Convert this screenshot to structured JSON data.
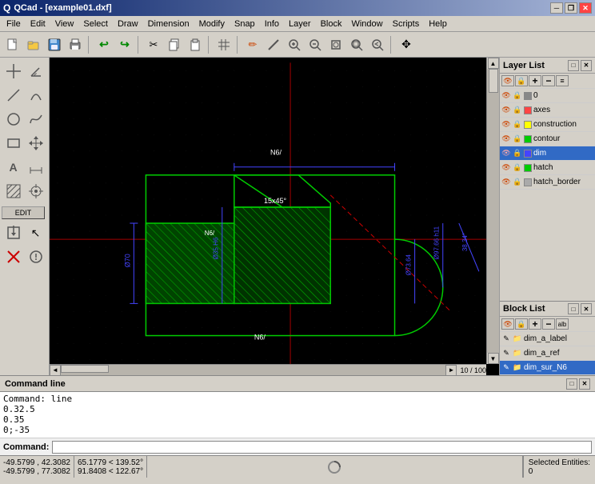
{
  "titlebar": {
    "title": "QCad - [example01.dxf]",
    "icon": "Q",
    "min_btn": "─",
    "max_btn": "□",
    "close_btn": "✕",
    "restore_btn": "❐"
  },
  "menubar": {
    "items": [
      "File",
      "Edit",
      "View",
      "Select",
      "Draw",
      "Dimension",
      "Modify",
      "Snap",
      "Info",
      "Layer",
      "Block",
      "Window",
      "Scripts",
      "Help"
    ]
  },
  "toolbar": {
    "buttons": [
      {
        "name": "new",
        "icon": "📄"
      },
      {
        "name": "open",
        "icon": "📂"
      },
      {
        "name": "save",
        "icon": "💾"
      },
      {
        "name": "print",
        "icon": "🖨"
      },
      {
        "name": "sep1",
        "icon": ""
      },
      {
        "name": "undo",
        "icon": "↩"
      },
      {
        "name": "redo",
        "icon": "↪"
      },
      {
        "name": "sep2",
        "icon": ""
      },
      {
        "name": "cut",
        "icon": "✂"
      },
      {
        "name": "copy",
        "icon": "📋"
      },
      {
        "name": "paste",
        "icon": "📌"
      },
      {
        "name": "sep3",
        "icon": ""
      },
      {
        "name": "grid",
        "icon": "⊞"
      },
      {
        "name": "sep4",
        "icon": ""
      },
      {
        "name": "draw-pen",
        "icon": "✏"
      },
      {
        "name": "draw-line",
        "icon": "/"
      },
      {
        "name": "zoom-in",
        "icon": "🔍"
      },
      {
        "name": "zoom-out",
        "icon": "🔍"
      },
      {
        "name": "zoom-extent",
        "icon": "⊕"
      },
      {
        "name": "zoom-window",
        "icon": "⊡"
      },
      {
        "name": "zoom-prev",
        "icon": "◁"
      },
      {
        "name": "pan",
        "icon": "✥"
      }
    ]
  },
  "left_toolbar": {
    "buttons": [
      {
        "name": "cross",
        "icon": "+",
        "label": ""
      },
      {
        "name": "angle",
        "icon": "∠"
      },
      {
        "name": "line-tool",
        "icon": "/"
      },
      {
        "name": "arc-tool",
        "icon": "◡"
      },
      {
        "name": "circle-tool",
        "icon": "○"
      },
      {
        "name": "curve-tool",
        "icon": "~"
      },
      {
        "name": "rect-tool",
        "icon": "▭"
      },
      {
        "name": "move-tool",
        "icon": "↔"
      },
      {
        "name": "text-tool",
        "icon": "A"
      },
      {
        "name": "dim-tool",
        "icon": "⊢"
      },
      {
        "name": "hatch-tool",
        "icon": "▦"
      },
      {
        "name": "snap-tool",
        "icon": "◈"
      },
      {
        "name": "edit-label",
        "label": "EDIT"
      },
      {
        "name": "insert-tool",
        "icon": "⊡"
      },
      {
        "name": "select-tool",
        "icon": "↖"
      },
      {
        "name": "delete-tool",
        "icon": "⊗"
      }
    ]
  },
  "canvas": {
    "background": "#000000",
    "scroll_position": "10 / 100"
  },
  "layer_list": {
    "title": "Layer List",
    "layers": [
      {
        "name": "0",
        "color": "#ffffff",
        "visible": true,
        "locked": false,
        "active": false
      },
      {
        "name": "axes",
        "color": "#ff0000",
        "visible": true,
        "locked": false,
        "active": false
      },
      {
        "name": "construction",
        "color": "#ffff00",
        "visible": true,
        "locked": false,
        "active": false
      },
      {
        "name": "contour",
        "color": "#00ff00",
        "visible": true,
        "locked": false,
        "active": false
      },
      {
        "name": "dim",
        "color": "#0000ff",
        "visible": true,
        "locked": false,
        "active": true
      },
      {
        "name": "hatch",
        "color": "#00ff00",
        "visible": true,
        "locked": false,
        "active": false
      },
      {
        "name": "hatch_border",
        "color": "#ffffff",
        "visible": true,
        "locked": false,
        "active": false
      }
    ]
  },
  "block_list": {
    "title": "Block List",
    "blocks": [
      {
        "name": "dim_a_label",
        "active": false
      },
      {
        "name": "dim_a_ref",
        "active": false
      },
      {
        "name": "dim_sur_N6",
        "active": true
      }
    ]
  },
  "command_line": {
    "title": "Command line",
    "output": [
      "Command: line",
      "0.32.5",
      "0.35",
      "0;-35"
    ],
    "input_label": "Command:",
    "input_value": ""
  },
  "statusbar": {
    "coord1_line1": "-49.5799 , 42.3082",
    "coord1_line2": "-49.5799 , 77.3082",
    "coord2_line1": "65.1779 < 139.52°",
    "coord2_line2": "91.8408 < 122.67°",
    "selected_label": "Selected Entities:",
    "selected_count": "0"
  }
}
